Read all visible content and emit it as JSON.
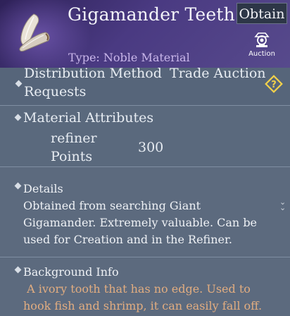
{
  "header": {
    "title": "Gigamander Teeth",
    "obtain_label": "Obtain",
    "auction_label": "Auction",
    "type_text": "Type: Noble Material"
  },
  "distribution": {
    "label_line1": "Distribution Method",
    "label_line2": "Requests",
    "value": "Trade Auction"
  },
  "material": {
    "heading": "Material Attributes",
    "attr_label_line1": "refiner",
    "attr_label_line2": "Points",
    "attr_value": "300"
  },
  "details": {
    "heading": "Details",
    "lines": [
      "Obtained from searching Giant",
      "Gigamander. Extremely valuable. Can be",
      "used for Creation and in the Refiner."
    ]
  },
  "background": {
    "heading": "Background Info",
    "lines": [
      " A ivory tooth that has no edge. Used to",
      "hook fish and shrimp, it can easily fall off."
    ]
  },
  "colors": {
    "header_purple": "#4a3a82",
    "panel_slate": "#5c6a7e",
    "type_lilac": "#c9b6ea",
    "lore_orange": "#e2ad80",
    "help_gold": "#f2d14a"
  },
  "icons": [
    "tooth-item-icon",
    "auction-icon",
    "help-icon",
    "chevron-down-icon",
    "diamond-bullet-icon"
  ]
}
